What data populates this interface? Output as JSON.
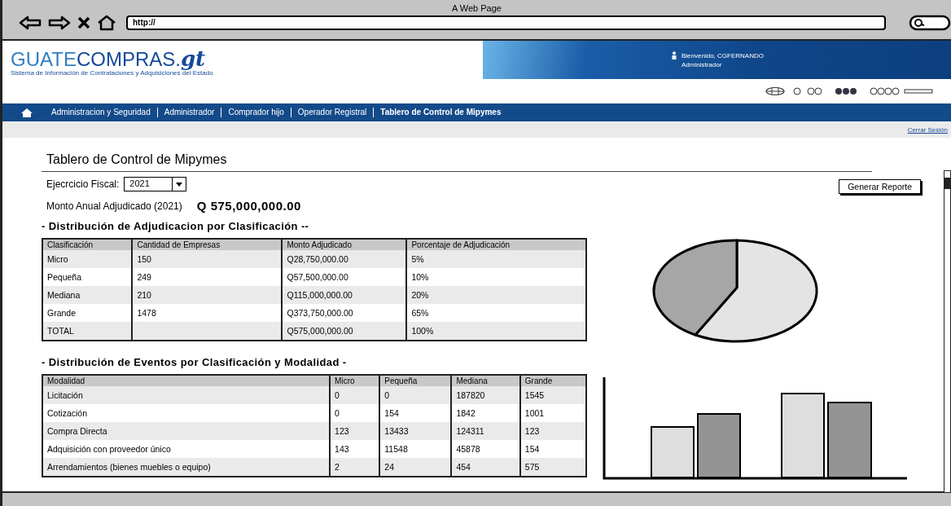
{
  "browser": {
    "title": "A Web Page",
    "url": "http://"
  },
  "header": {
    "logo": {
      "word1": "GUATE",
      "word2": "COMPRAS.",
      "script": "gt",
      "subtitle": "Sistema de Información de Contrataciones y Adquisiciones del Estado"
    },
    "user": {
      "greeting": "Bienvenido, CGFERNANDO",
      "role": "Administrador"
    }
  },
  "nav": {
    "items": [
      {
        "label": "Administracion y Seguridad",
        "selected": false
      },
      {
        "label": "Administrador",
        "selected": false
      },
      {
        "label": "Comprador hijo",
        "selected": false
      },
      {
        "label": "Operador Registral",
        "selected": false
      },
      {
        "label": "Tablero de Control de Mipymes",
        "selected": true
      }
    ],
    "logout": "Cerrar Sesión"
  },
  "page": {
    "title": "Tablero de Control de Mipymes",
    "fiscal": {
      "label": "Ejecrcicio Fiscal:",
      "value": "2021"
    },
    "annual": {
      "label": "Monto Anual Adjudicado (2021)",
      "amount": "Q 575,000,000.00"
    },
    "button": "Generar Reporte"
  },
  "section1": {
    "title": "- Distribución de Adjudicacion por Clasificación --",
    "columns": [
      "Clasificación",
      "Cantidad de Empresas",
      "Monto Adjudicado",
      "Porcentaje de Adjudicación"
    ],
    "rows": [
      [
        "Micro",
        "150",
        "Q28,750,000.00",
        "5%"
      ],
      [
        "Pequeña",
        "249",
        "Q57,500,000.00",
        "10%"
      ],
      [
        "Mediana",
        "210",
        "Q115,000,000.00",
        "20%"
      ],
      [
        "Grande",
        "1478",
        "Q373,750,000.00",
        "65%"
      ],
      [
        "TOTAL",
        "",
        "Q575,000,000.00",
        "100%"
      ]
    ]
  },
  "section2": {
    "title": "- Distribución de Eventos por Clasificación y Modalidad -",
    "columns": [
      "Modalidad",
      "Micro",
      "Pequeña",
      "Mediana",
      "Grande"
    ],
    "rows": [
      [
        "Licitación",
        "0",
        "0",
        "187820",
        "1545"
      ],
      [
        "Cotización",
        "0",
        "154",
        "1842",
        "1001"
      ],
      [
        "Compra Directa",
        "123",
        "13433",
        "124311",
        "123"
      ],
      [
        "Adquisición con proveedor único",
        "143",
        "11548",
        "45878",
        "154"
      ],
      [
        "Arrendamientos (bienes muebles o equipo)",
        "2",
        "24",
        "454",
        "575"
      ]
    ]
  }
}
